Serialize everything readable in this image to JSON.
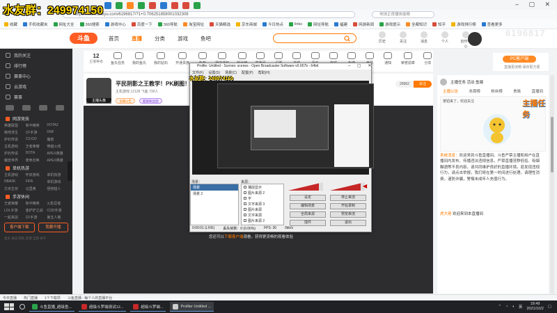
{
  "overlay": {
    "title": "水友群：249974150"
  },
  "browser": {
    "url": "https://www.douyu.com/6196817/?1+0.706251858001032308",
    "search_placeholder": "地球正夜播体能睛",
    "tab_icons": [
      "blue",
      "green",
      "orange",
      "green",
      "red",
      "blue",
      "red",
      "red",
      "green"
    ]
  },
  "bookmarks": [
    "收藏",
    "手机收藏夹",
    "网址大全",
    "360搜索",
    "游戏中心",
    "百度一下",
    "360导航",
    "淘宝网址",
    "天猫精选",
    "京东商城",
    "今日热点",
    "links",
    "网址导航",
    "福建",
    "网游新闻",
    "游戏提示",
    "全都知识",
    "知乎",
    "游戏排行榜",
    "查看更多"
  ],
  "header": {
    "logo": "斗鱼",
    "nav": [
      "首页",
      "直播",
      "分类",
      "游戏",
      "鱼吧"
    ],
    "icons": [
      "历史",
      "关注",
      "消息",
      "个人",
      "创作中心"
    ],
    "watermark": "6196817"
  },
  "sidebar": {
    "rows": [
      "我的关注",
      "排行榜",
      "赛事中心",
      "云游戏",
      "赛事"
    ],
    "sections": [
      {
        "title": "网游竞技",
        "items": [
          "英雄联盟",
          "和平精英",
          "DOTA2",
          "绝地求生",
          "CF手游",
          "DNF",
          "炉石传说",
          "CS:GO",
          "魔兽",
          "主机游戏",
          "王者荣耀",
          "穿越火线",
          "炉石传说",
          "DOTA",
          "APEX英雄",
          "魔兽世界",
          "使命召唤",
          "APEX英雄"
        ]
      },
      {
        "title": "单机热游",
        "items": [
          "主机游戏",
          "怀旧游戏",
          "单机热游",
          "NBA2K",
          "FIFA",
          "单机游戏",
          "方舟生存",
          "马里奥",
          "怪物猎人"
        ]
      },
      {
        "title": "手游休闲",
        "items": [
          "王者荣耀",
          "和平精英",
          "火影忍者",
          "LOL手游",
          "金铲铲之战",
          "COD手游",
          "一起来捉",
          "CF手游",
          "第五人格"
        ]
      }
    ],
    "btn_download": "客户端下载",
    "btn_live": "我要开播",
    "footer": "鱼乐 协议 隐私 反馈 全部 关于"
  },
  "categories": {
    "count": "12",
    "count_label": "主播等级",
    "items": [
      "鱼丸任务",
      "我的鱼丸",
      "我的钻石",
      "开通贵族",
      "鱼吧",
      "我的背包",
      "粉丝榜",
      "直播间",
      "设置",
      "抽奖",
      "活动",
      "商城",
      "鱼塘",
      "竞猜",
      "通知",
      "荣誉勋章",
      "分享"
    ]
  },
  "pc_card": {
    "btn": "PC客户端",
    "sub": "直播更流畅 保存更方便"
  },
  "room": {
    "title": "平民阴影之王教学！PK刷图！",
    "meta": "主机游戏  12128  飞鱼  730人",
    "tag1": "主播公告",
    "tag2": "超级粉丝团",
    "caption_avatar": "主播头像",
    "follow_count": "28962",
    "follow_btn": "关注"
  },
  "player": {
    "caption_pre": "您还可以",
    "caption_link": "下载客户端",
    "caption_post": "观看，获得更流畅的观看体验"
  },
  "obs": {
    "title": "Profile: Untitled - Scenes: scenes - Open Broadcaster Software v0.657b - 64bit",
    "menu": [
      "文件(F)",
      "设置(S)",
      "场景(C)",
      "配置(P)",
      "帮助(H)"
    ],
    "overlay_text": "水友群：249974150",
    "scenes_label": "场景：",
    "sources_label": "来源：",
    "scenes": [
      "场景",
      "场景 2"
    ],
    "sources": [
      "捕捉显示",
      "图片来源 2",
      "字",
      "文字来源 3",
      "图片来源",
      "文字来源",
      "图片来源 2",
      "检测",
      "显示器捕捉"
    ],
    "buttons": [
      "设定",
      "停止串流",
      "编辑场景",
      "开始录制",
      "全局来源",
      "预览串流",
      "插件",
      "退出"
    ],
    "status": [
      "0:00:01 (LIVE)",
      "丢失帧数：0 (0.00%)",
      "FPS: 30",
      "0kb/s"
    ]
  },
  "right_panel": {
    "header": "主播任务  活动  鱼塘",
    "tabs": [
      "主播公告",
      "本周榜",
      "粉丝榜",
      "贵族",
      "直播间"
    ],
    "board_text": "按钮来了，欢迎关注",
    "logo": "主播任务",
    "notice_label": "系统消息：",
    "notice": "欢迎来到斗鱼直播间。斗鱼严禁主播和用户在直播间内发布、传播违法违规信息，严禁直播淫秽低俗、吸烟酗酒等不良内容，请共同维护良好的直播环境。若发现违规行为，请点击举报，我们将在第一时间进行处理。请理性消费，谨防诈骗，警惕未成年人充值行为。",
    "welcome_user": "虎大佬",
    "welcome_text": "欢迎来到本直播间"
  },
  "statusbar": [
    "今日直播",
    "热门直播",
    "1个下载项",
    "斗鱼直播 - 每个人的直播平台"
  ],
  "taskbar": {
    "tasks": [
      {
        "label": "斗鱼直播_超级鱼...",
        "color": "#2aa34a"
      },
      {
        "label": "超级斗罗端测试12...",
        "color": "#c62828"
      },
      {
        "label": "超级斗罗端...",
        "color": "#c62828"
      },
      {
        "label": "Profiler Untitled ...",
        "color": "#cccccc"
      }
    ],
    "time": "18:49",
    "date": "2021/10/2",
    "lang": "英"
  }
}
